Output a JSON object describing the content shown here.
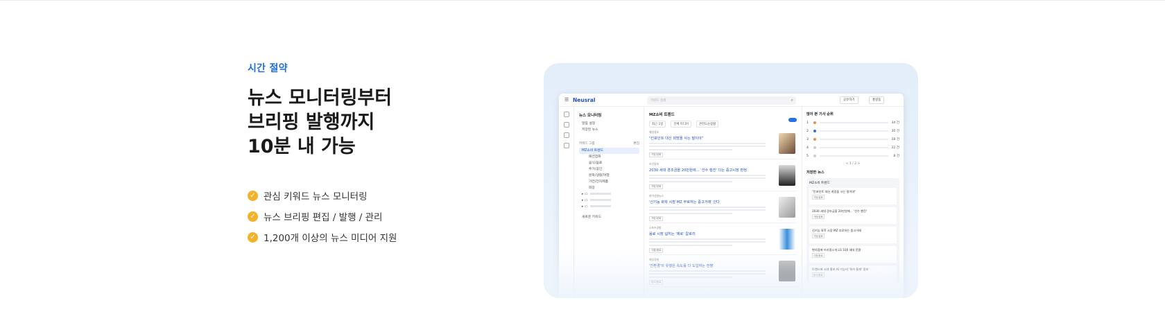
{
  "section": {
    "eyebrow": "시간 절약",
    "headline_line1": "뉴스 모니터링부터",
    "headline_line2": "브리핑 발행까지",
    "headline_line3": "10분 내 가능",
    "features": [
      "관심 키워드 뉴스 모니터링",
      "뉴스 브리핑 편집 / 발행 / 관리",
      "1,200개 이상의 뉴스 미디어 지원"
    ],
    "check_color": "#f4b22a",
    "accent_color": "#1f6fd6"
  },
  "app": {
    "logo": "Neusral",
    "search_placeholder": "키워드 검색",
    "top_button_1": "공유하기",
    "top_button_2": "홍길동",
    "sidebar": {
      "title": "뉴스 모니터링",
      "items": [
        "알림 설정",
        "저장된 뉴스"
      ],
      "group_label": "키워드 그룹",
      "group_action": "편집",
      "selected_group": "MZ소비 트렌드",
      "sub_items": [
        "패션잡화",
        "음식/음료",
        "주거/공간",
        "문화/생활/여행",
        "가전/전자제품",
        "화장"
      ],
      "add_label": "새로운 키워드"
    },
    "main": {
      "title": "MZ소비 트렌드",
      "filters": [
        "최근 1일",
        "전체 미디어",
        "관련도순정렬"
      ],
      "articles": [
        {
          "source": "매일일보",
          "title": "\"킨포인트 대신 희망을 사는 말이야\"",
          "tag": "가방/잡화"
        },
        {
          "source": "조선일보",
          "title": "2030 세대 경조금을 20만원에... '선수 행진' 다는 중고시장 판정",
          "tag": "가방/잡화"
        },
        {
          "source": "파이낸셜뉴스",
          "title": "'신기능 화학 시장 MZ 부로하는 중고거래' 인다",
          "tag": "가방/잡화"
        },
        {
          "source": "스포츠경향",
          "title": "음료 시장 넓히는 '제로' 칼로리",
          "tag": "식품/음료"
        },
        {
          "source": "매일경제",
          "title": "'친환경'의 유행은 속도를 다 도입하는 전향",
          "tag": "음식/음료"
        }
      ]
    },
    "right": {
      "title": "많이 본 기사 순위",
      "ranks": [
        {
          "n": "1",
          "count": "34 건"
        },
        {
          "n": "2",
          "count": "30 건"
        },
        {
          "n": "3",
          "count": "28 건"
        },
        {
          "n": "4",
          "count": "22 건"
        },
        {
          "n": "5",
          "count": "8 건"
        }
      ],
      "pager": "< 1 / 2 >",
      "saved_title": "저장한 뉴스",
      "panel_title": "MZ소비 트렌드",
      "cards": [
        {
          "title": "\"킨포인트 대신 희망을 사는 말이야\"",
          "tag": "가방/잡화"
        },
        {
          "title": "2030 세대 경조금을 20만원에... '선수 행진'",
          "tag": "가방/잡화"
        },
        {
          "title": "신기능 화학 시장 MZ 부로하는 중고거래",
          "tag": "가방/잡화"
        },
        {
          "title": "편의점에 브리핑소개 LG 100 세대 전환",
          "tag": "식품/음료"
        },
        {
          "title": "트렌드에 시대 홍보 AI 기능의 '특허 통계' 정보",
          "tag": "음식/음료"
        }
      ]
    }
  }
}
